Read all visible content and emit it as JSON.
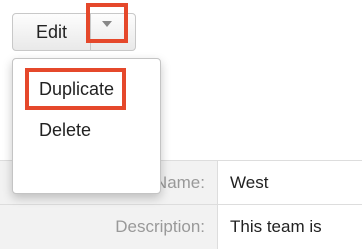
{
  "toolbar": {
    "edit_label": "Edit",
    "dropdown_caret_icon": "caret-down-icon",
    "highlight_color": "#e5482b"
  },
  "dropdown": {
    "items": [
      {
        "label": "Duplicate",
        "highlighted": true
      },
      {
        "label": "Delete",
        "highlighted": false
      }
    ]
  },
  "detail": {
    "rows": [
      {
        "label": "Team Name:",
        "value": "West"
      },
      {
        "label": "Description:",
        "value": "This team is"
      }
    ]
  }
}
